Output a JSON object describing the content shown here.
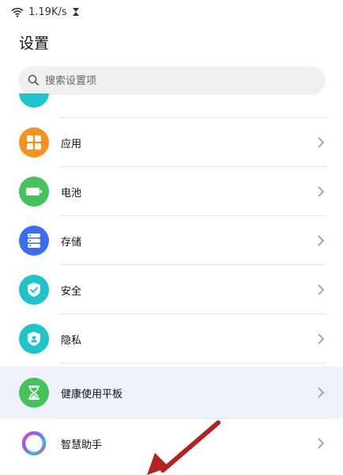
{
  "status_bar": {
    "network_speed": "1.19K/s"
  },
  "page": {
    "title": "设置"
  },
  "search": {
    "placeholder": "搜索设置项"
  },
  "items": [
    {
      "label": "应用",
      "icon": "apps-grid-icon",
      "color": "#f5921e"
    },
    {
      "label": "电池",
      "icon": "battery-icon",
      "color": "#44c35a"
    },
    {
      "label": "存储",
      "icon": "storage-icon",
      "color": "#3b6df0"
    },
    {
      "label": "安全",
      "icon": "shield-check-icon",
      "color": "#1ec4c9"
    },
    {
      "label": "隐私",
      "icon": "privacy-shield-icon",
      "color": "#1ec4c9"
    },
    {
      "label": "健康使用平板",
      "icon": "hourglass-icon",
      "color": "#44c35a",
      "highlighted": true
    },
    {
      "label": "智慧助手",
      "icon": "assistant-ring-icon",
      "color": "#8a5cf0"
    }
  ],
  "colors": {
    "accent": "#3b6df0",
    "highlight": "#eef0fb",
    "annotation_arrow": "#b22222"
  }
}
